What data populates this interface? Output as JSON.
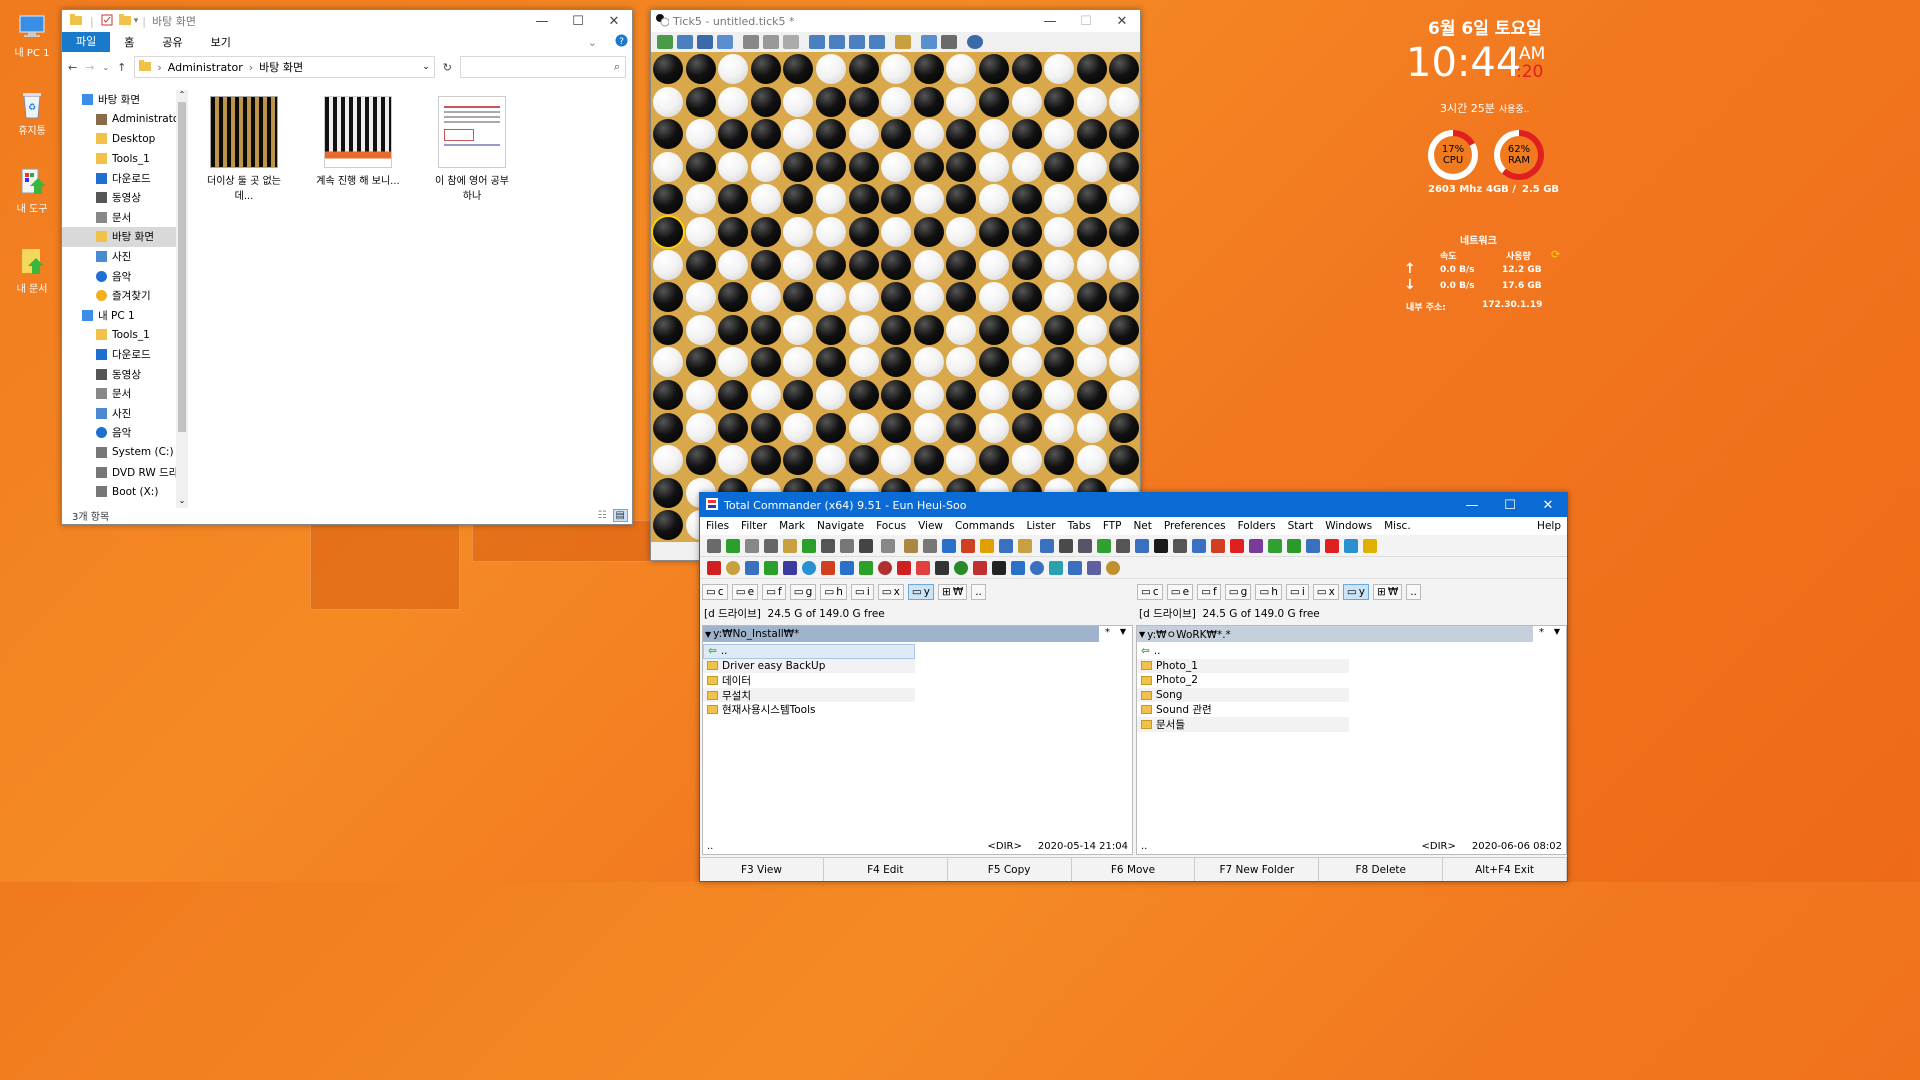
{
  "desktop_icons": [
    {
      "label": "내 PC 1",
      "icon": "computer-icon"
    },
    {
      "label": "휴지통",
      "icon": "recycle-bin-icon"
    },
    {
      "label": "내 도구",
      "icon": "tools-shortcut-icon"
    },
    {
      "label": "내 문서",
      "icon": "documents-shortcut-icon"
    }
  ],
  "explorer": {
    "title": "바탕 화면",
    "ribbon": {
      "file": "파일",
      "home": "홈",
      "share": "공유",
      "view": "보기"
    },
    "path": [
      "Administrator",
      "바탕 화면"
    ],
    "search_placeholder": "",
    "tree": [
      {
        "label": "바탕 화면",
        "icon": "desktop-folder-icon",
        "level": 0
      },
      {
        "label": "Administrator",
        "icon": "user-icon",
        "level": 1
      },
      {
        "label": "Desktop",
        "icon": "folder-icon",
        "level": 1
      },
      {
        "label": "Tools_1",
        "icon": "folder-icon",
        "level": 1
      },
      {
        "label": "다운로드",
        "icon": "download-icon",
        "level": 1
      },
      {
        "label": "동영상",
        "icon": "video-icon",
        "level": 1
      },
      {
        "label": "문서",
        "icon": "document-icon",
        "level": 1
      },
      {
        "label": "바탕 화면",
        "icon": "folder-icon",
        "level": 1,
        "selected": true
      },
      {
        "label": "사진",
        "icon": "pictures-icon",
        "level": 1
      },
      {
        "label": "음악",
        "icon": "music-icon",
        "level": 1
      },
      {
        "label": "즐겨찾기",
        "icon": "star-icon",
        "level": 1
      },
      {
        "label": "내 PC 1",
        "icon": "computer-icon",
        "level": 0
      },
      {
        "label": "Tools_1",
        "icon": "folder-icon",
        "level": 1
      },
      {
        "label": "다운로드",
        "icon": "download-icon",
        "level": 1
      },
      {
        "label": "동영상",
        "icon": "video-icon",
        "level": 1
      },
      {
        "label": "문서",
        "icon": "document-icon",
        "level": 1
      },
      {
        "label": "사진",
        "icon": "pictures-icon",
        "level": 1
      },
      {
        "label": "음악",
        "icon": "music-icon",
        "level": 1
      },
      {
        "label": "System (C:)",
        "icon": "drive-icon",
        "level": 1
      },
      {
        "label": "DVD RW 드라",
        "icon": "dvd-icon",
        "level": 1
      },
      {
        "label": "Boot (X:)",
        "icon": "drive-icon",
        "level": 1
      }
    ],
    "files": [
      {
        "name": "더이상 둘 곳 없는데...",
        "kind": "board-thumbnail"
      },
      {
        "name": "계속 진행 해 보니...",
        "kind": "board-thumbnail-red"
      },
      {
        "name": "이 참에 영어 공부 하나",
        "kind": "document-thumbnail"
      }
    ],
    "status": "3개 항목"
  },
  "tick5": {
    "title": "Tick5 - untitled.tick5 *",
    "board": [
      "BBWBBWBWBWBBWBB",
      "WBWBWBBWBWBWBWW",
      "BWBBWBWBWBWBWBB",
      "WBWWBBBWBBWWBWB",
      "BWBWBWBBWBWBWBW",
      "BWBBWWBWBWBBWBB",
      "WBWBWBBBWBWBWWW",
      "BWBWBWWBWBWBWBB",
      "BWBBWBWBBWBWBWB",
      "WBWBWBWBWWBWBWW",
      "BWBWBWBBWBWBWBW",
      "BWBBWBWBWBWBWWB",
      "WBWBBWBWBWBWBWB",
      "BWBWBBWBWBWBWBW",
      "BWBBWBWBWBWBWBB"
    ],
    "highlight": {
      "row": 5,
      "col": 0
    }
  },
  "total_commander": {
    "title": "Total Commander (x64) 9.51 - Eun Heui-Soo",
    "menu": [
      "Files",
      "Filter",
      "Mark",
      "Navigate",
      "Focus",
      "View",
      "Commands",
      "Lister",
      "Tabs",
      "FTP",
      "Net",
      "Preferences",
      "Folders",
      "Start",
      "Windows",
      "Misc."
    ],
    "help": "Help",
    "drives": [
      "c",
      "e",
      "f",
      "g",
      "h",
      "i",
      "x",
      "y",
      "₩",
      ".."
    ],
    "left": {
      "drive_info": "[d 드라이브]  24.5 G of 149.0 G free",
      "path": "y:₩No_Install₩*",
      "files": [
        "..",
        "Driver easy BackUp",
        "데이터",
        "무설치",
        "현재사용시스템Tools"
      ],
      "status_dir": "<DIR>",
      "status_date": "2020-05-14 21:04",
      "status_name": ".."
    },
    "right": {
      "drive_info": "[d 드라이브]  24.5 G of 149.0 G free",
      "path": "y:₩ㅇWoRK₩*.*",
      "files": [
        "..",
        "Photo_1",
        "Photo_2",
        "Song",
        "Sound 관련",
        "문서들"
      ],
      "status_dir": "<DIR>",
      "status_date": "2020-06-06 08:02",
      "status_name": ".."
    },
    "fkeys": [
      "F3 View",
      "F4 Edit",
      "F5 Copy",
      "F6 Move",
      "F7 New Folder",
      "F8 Delete",
      "Alt+F4 Exit"
    ]
  },
  "widget": {
    "date": "6월 6일 토요일",
    "time": "10:44",
    "ampm": "AM",
    "seconds": ":20",
    "uptime": "3시간 25분",
    "uptime_suffix": "사용중..",
    "cpu_percent": "17%",
    "cpu_label": "CPU",
    "cpu_value": 0.17,
    "ram_percent": "62%",
    "ram_label": "RAM",
    "ram_value": 0.62,
    "cpu_mhz": "2603 Mhz",
    "ram_total": "4GB /",
    "ram_used": "2.5 GB",
    "net_title": "네트워크",
    "col_speed": "속도",
    "col_usage": "사용량",
    "up_speed": "0.0 B/s",
    "up_usage": "12.2 GB",
    "down_speed": "0.0 B/s",
    "down_usage": "17.6 GB",
    "ip_label": "내부 주소:",
    "ip": "172.30.1.19",
    "accent": "#e02020"
  }
}
